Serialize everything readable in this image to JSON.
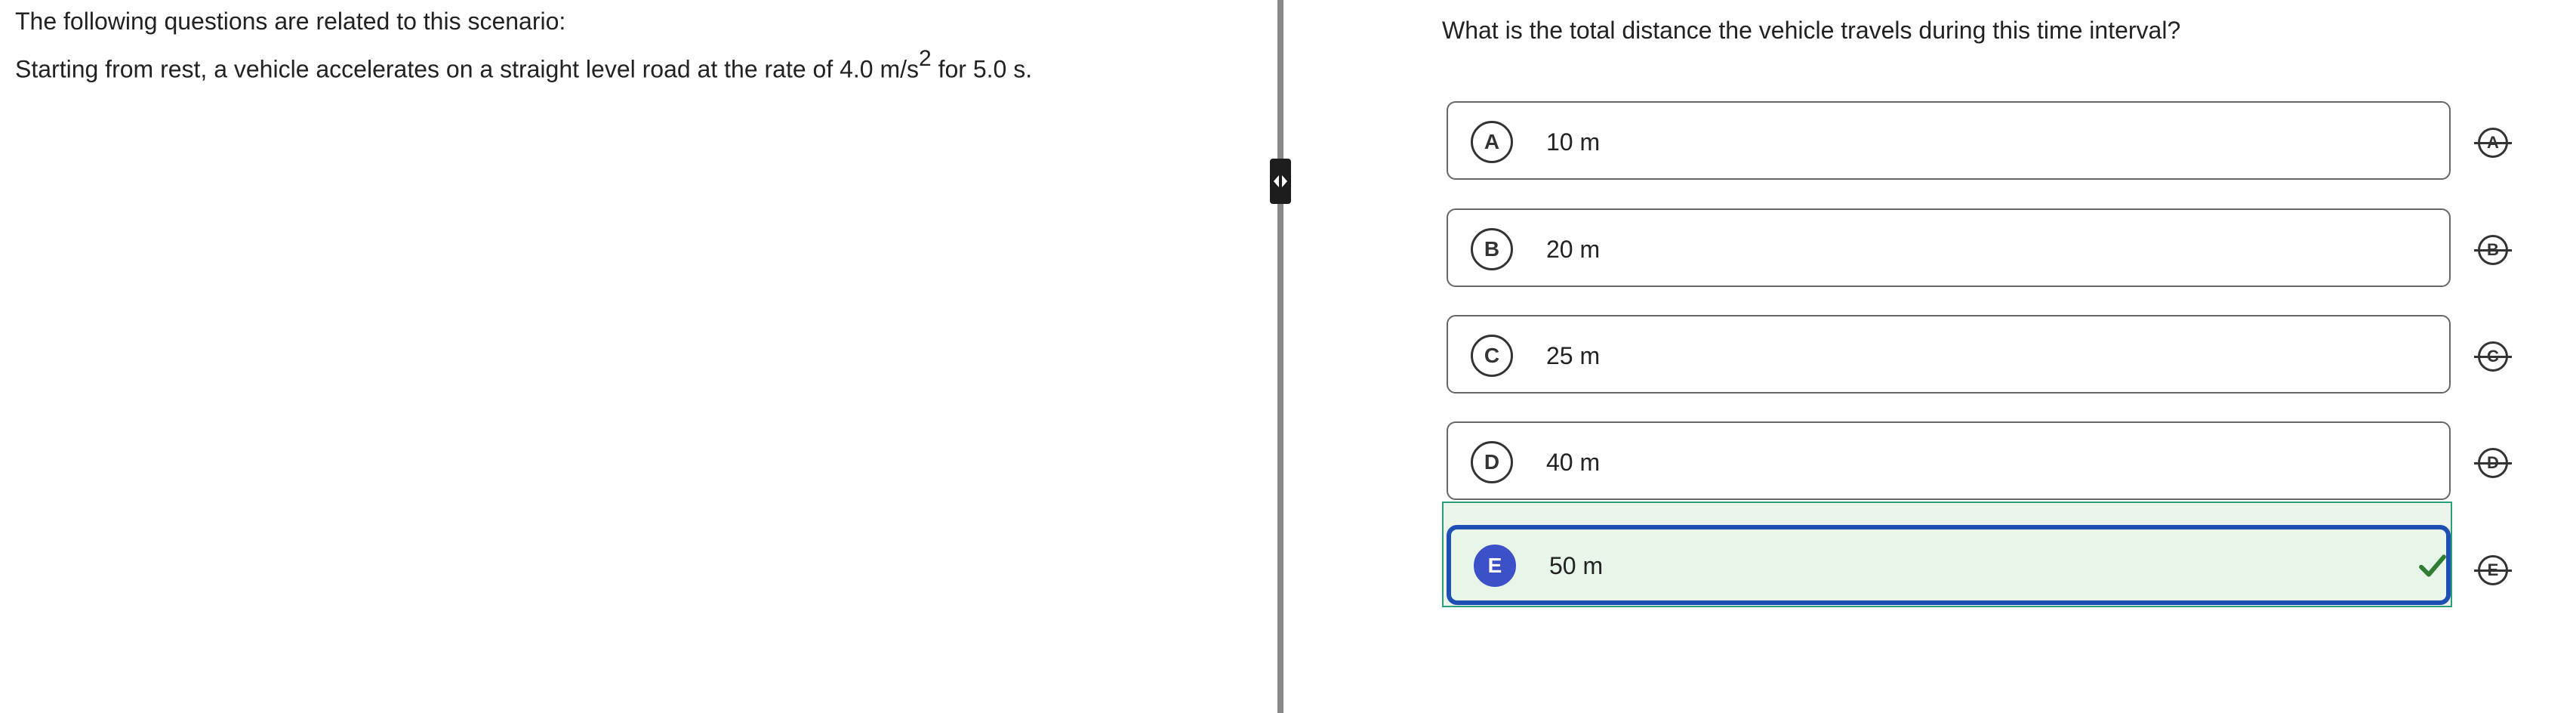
{
  "passage": {
    "intro": "The following questions are related to this scenario:",
    "scenario_before": "Starting from rest, a vehicle accelerates on a straight level road at the rate of 4.0 m/s",
    "scenario_sup": "2",
    "scenario_after": " for 5.0 s."
  },
  "question": {
    "text": "What is the total distance the vehicle travels during this time interval?"
  },
  "options": [
    {
      "letter": "A",
      "text": "10 m"
    },
    {
      "letter": "B",
      "text": "20 m"
    },
    {
      "letter": "C",
      "text": "25 m"
    },
    {
      "letter": "D",
      "text": "40 m"
    },
    {
      "letter": "E",
      "text": "50 m"
    }
  ],
  "selected_option": "E",
  "icons": {
    "divider_handle": "resize-handle-icon",
    "selected_mark": "checkmark-icon",
    "strike_buttons": "strikethrough-letter-icon"
  },
  "colors": {
    "selected_border": "#1e50b4",
    "selected_fill": "#e8f5e9",
    "selected_letter_bg": "#3c50c8",
    "check_green": "#2e7d32",
    "divider": "#888888"
  }
}
